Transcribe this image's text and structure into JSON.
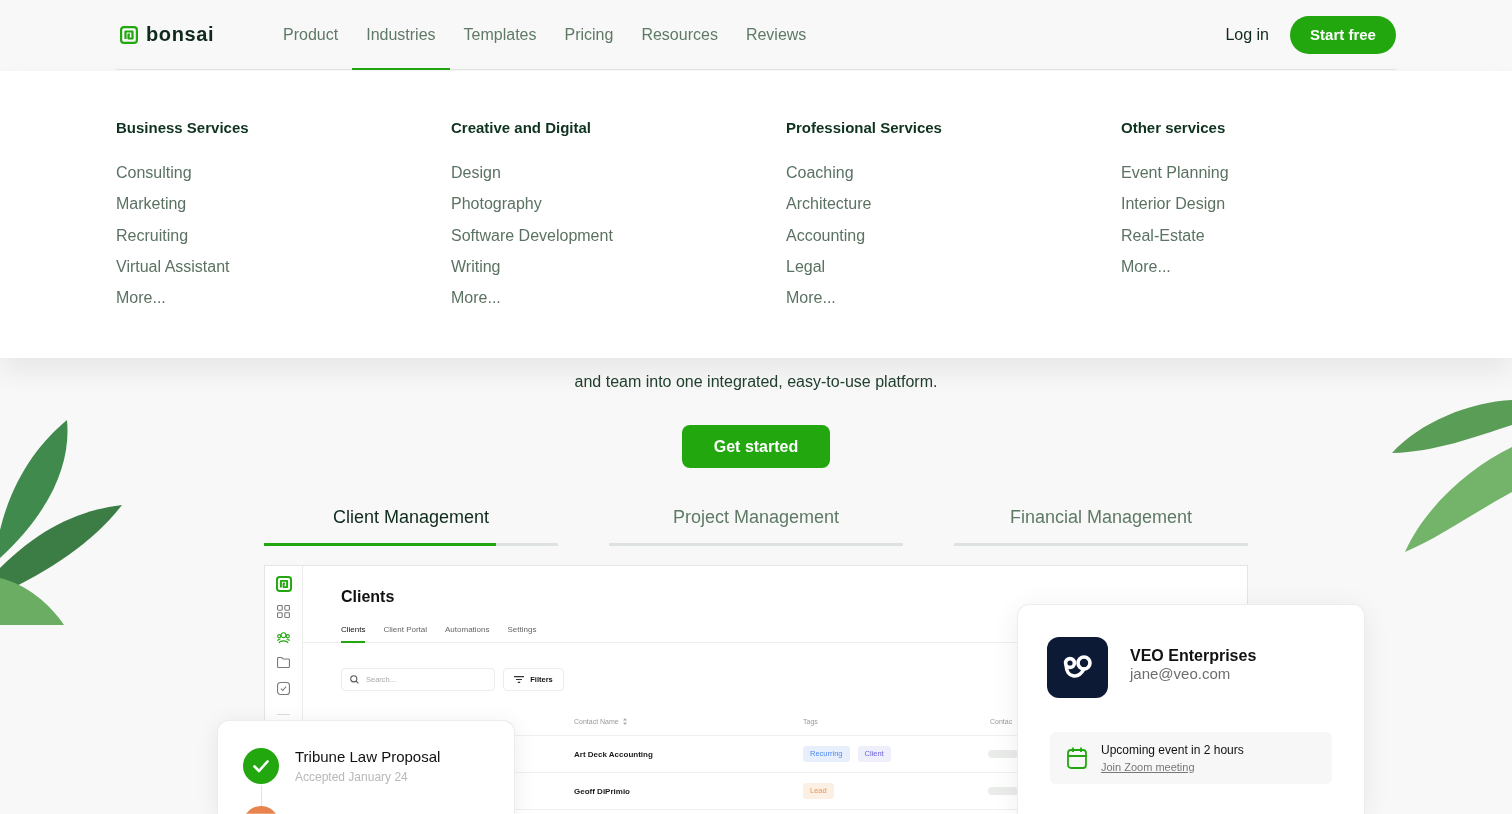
{
  "header": {
    "logo": "bonsai",
    "nav": [
      {
        "label": "Product",
        "selected": false
      },
      {
        "label": "Industries",
        "selected": true
      },
      {
        "label": "Templates",
        "selected": false
      },
      {
        "label": "Pricing",
        "selected": false
      },
      {
        "label": "Resources",
        "selected": false
      },
      {
        "label": "Reviews",
        "selected": false
      }
    ],
    "login": "Log in",
    "cta": "Start free"
  },
  "industries_menu": {
    "columns": [
      {
        "heading": "Business Services",
        "items": [
          "Consulting",
          "Marketing",
          "Recruiting",
          "Virtual Assistant",
          "More..."
        ]
      },
      {
        "heading": "Creative and Digital",
        "items": [
          "Design",
          "Photography",
          "Software Development",
          "Writing",
          "More..."
        ]
      },
      {
        "heading": "Professional Services",
        "items": [
          "Coaching",
          "Architecture",
          "Accounting",
          "Legal",
          "More..."
        ]
      },
      {
        "heading": "Other services",
        "items": [
          "Event Planning",
          "Interior Design",
          "Real-Estate",
          "More..."
        ]
      }
    ]
  },
  "hero": {
    "subtitle": "and team into one integrated, easy-to-use platform.",
    "button": "Get started"
  },
  "product_tabs": [
    {
      "label": "Client Management",
      "selected": true,
      "level": 0.79
    },
    {
      "label": "Project Management",
      "selected": false,
      "level": 0
    },
    {
      "label": "Financial Management",
      "selected": false,
      "level": 0
    }
  ],
  "app_preview": {
    "sidebar": [
      {
        "kind": "grid",
        "selected": false
      },
      {
        "kind": "people",
        "selected": true
      },
      {
        "kind": "folder",
        "selected": false
      },
      {
        "kind": "task",
        "selected": false
      }
    ],
    "title": "Clients",
    "tabs": [
      {
        "label": "Clients",
        "selected": true
      },
      {
        "label": "Client Portal",
        "selected": false
      },
      {
        "label": "Automations",
        "selected": false
      },
      {
        "label": "Settings",
        "selected": false
      }
    ],
    "search": {
      "placeholder": "Search..."
    },
    "filters_button": "Filters",
    "table": {
      "columns": [
        {
          "label": "Contact Name",
          "sortable": true
        },
        {
          "label": "Tags",
          "sortable": false
        },
        {
          "label": "Contac",
          "sortable": false
        }
      ],
      "rows": [
        {
          "contact_name": "Art Deck Accounting",
          "tags": [
            {
              "label": "Recurring",
              "color": "#e7effd"
            },
            {
              "label": "Client",
              "color": "#efeefb"
            }
          ]
        },
        {
          "contact_name": "Geoff DiPrimio",
          "tags": [
            {
              "label": "Lead",
              "color": "#fcefe4"
            }
          ]
        }
      ]
    }
  },
  "proposal_card": {
    "items": [
      {
        "title": "Tribune Law Proposal",
        "subtitle": "Accepted January 24",
        "checked": true,
        "color": "#22a70f"
      },
      {
        "checked": false,
        "color": "#e9834e"
      }
    ]
  },
  "client_card": {
    "name": "VEO Enterprises",
    "email": "jane@veo.com",
    "event": {
      "title": "Upcoming event in 2 hours",
      "link": "Join Zoom meeting"
    }
  }
}
